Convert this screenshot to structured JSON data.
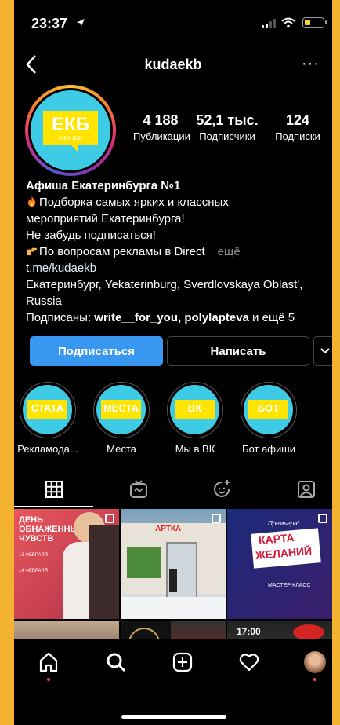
{
  "status": {
    "time": "23:37"
  },
  "nav": {
    "title": "kudaekb",
    "more": "···"
  },
  "profile": {
    "avatar_text": "ЕКБ",
    "avatar_subtext": "АФИША",
    "stats": [
      {
        "value": "4 188",
        "label": "Публикации"
      },
      {
        "value": "52,1 тыс.",
        "label": "Подписчики"
      },
      {
        "value": "124",
        "label": "Подписки"
      }
    ]
  },
  "bio": {
    "name": "Афиша Екатеринбурга №1",
    "line1": "Подборка самых ярких и классных",
    "line2": "мероприятий Екатеринбурга!",
    "line3": "Не забудь подписаться!",
    "line4": "По вопросам рекламы в Direct",
    "more": "ещё",
    "link": "t.me/kudaekb",
    "location1": "Екатеринбург, Yekaterinburg, Sverdlovskaya Oblast',",
    "location2": "Russia",
    "followed_prefix": "Подписаны:",
    "followed_user1": "write__for_you",
    "followed_sep": ",",
    "followed_user2": "polylapteva",
    "followed_suffix": "и ещё 5"
  },
  "buttons": {
    "follow": "Подписаться",
    "message": "Написать"
  },
  "highlights": [
    {
      "badge": "СТАТА",
      "label": "Рекламода..."
    },
    {
      "badge": "МЕСТА",
      "label": "Места"
    },
    {
      "badge": "ВК",
      "label": "Мы в ВК"
    },
    {
      "badge": "БОТ",
      "label": "Бот афиши"
    }
  ],
  "posts": {
    "p1": {
      "title1": "ДЕНЬ",
      "title2": "ОБНАЖЕННЫХ",
      "title3": "ЧУВСТВ",
      "date1": "13 ФЕВРАЛЯ",
      "date2": "14 ФЕВРАЛЯ"
    },
    "p2": {
      "sign": "АРТКА"
    },
    "p3": {
      "top": "Премьера!",
      "title1": "КАРТА",
      "title2": "ЖЕЛАНИЙ",
      "sub": "МАСТЕР-КЛАСС"
    },
    "p6": {
      "time": "17:00"
    }
  }
}
